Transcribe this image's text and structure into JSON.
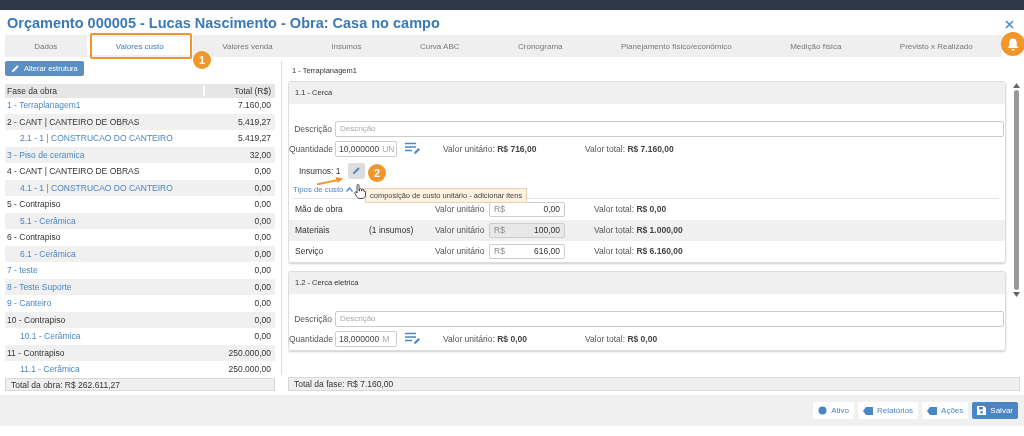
{
  "window": {
    "title": "Orçamento 000005 - Lucas Nascimento - Obra: Casa no campo"
  },
  "tabs": [
    {
      "label": "Dados",
      "selected": false
    },
    {
      "label": "Valores custo",
      "selected": true
    },
    {
      "label": "Valores venda",
      "selected": false
    },
    {
      "label": "Insumos",
      "selected": false
    },
    {
      "label": "Curva ABC",
      "selected": false
    },
    {
      "label": "Cronograma",
      "selected": false
    },
    {
      "label": "Planejamento físico/econômico",
      "selected": false
    },
    {
      "label": "Medição física",
      "selected": false
    },
    {
      "label": "Previsto x Realizado",
      "selected": false
    }
  ],
  "left_panel": {
    "button": "Alterar estrutura",
    "table": {
      "columns": [
        "Fase da obra",
        "Total (R$)"
      ],
      "rows": [
        {
          "label": "1 - Terraplanagem1",
          "total": "7.160,00"
        },
        {
          "label": "2 - CANT | CANTEIRO DE OBRAS",
          "total": "5.419,27",
          "children": [
            {
              "label": "2.1 - 1 | CONSTRUCAO DO CANTEIRO",
              "total": "5.419,27"
            }
          ]
        },
        {
          "label": "3 - Piso de ceramica",
          "total": "32,00"
        },
        {
          "label": "4 - CANT | CANTEIRO DE OBRAS",
          "total": "0,00",
          "children": [
            {
              "label": "4.1 - 1 | CONSTRUCAO DO CANTEIRO",
              "total": "0,00"
            }
          ]
        },
        {
          "label": "5 - Contrapiso",
          "total": "0,00",
          "children": [
            {
              "label": "5.1 - Cerâmica",
              "total": "0,00"
            }
          ]
        },
        {
          "label": "6 - Contrapiso",
          "total": "0,00",
          "children": [
            {
              "label": "6.1 - Cerâmica",
              "total": "0,00"
            }
          ]
        },
        {
          "label": "7 - teste",
          "total": "0,00"
        },
        {
          "label": "8 - Teste Suporte",
          "total": "0,00"
        },
        {
          "label": "9 - Canteiro",
          "total": "0,00"
        },
        {
          "label": "10 - Contrapiso",
          "total": "0,00",
          "children": [
            {
              "label": "10.1 - Cerâmica",
              "total": "0,00"
            }
          ]
        },
        {
          "label": "11 - Contrapiso",
          "total": "250.000,00",
          "children": [
            {
              "label": "11.1 - Cerâmica",
              "total": "250.000,00"
            }
          ]
        }
      ]
    },
    "total": "Total da obra: R$ 262.611,27"
  },
  "right_panel": {
    "heading": "1 - Terraplanagem1",
    "cards": [
      {
        "title": "1.1 - Cerca",
        "description_label": "Descrição",
        "description_placeholder": "Descrição",
        "quantity_label": "Quantidade",
        "quantity": "10,000000",
        "unit": "UN",
        "unit_price_label": "Valor unitário:",
        "unit_price": "R$ 716,00",
        "total_label": "Valor total:",
        "total": "R$ 7.160,00",
        "insumos": "Insumos: 1",
        "cost_types": {
          "label": "Tipos de custo",
          "expanded": true,
          "rows": [
            {
              "name": "Mão de obra",
              "note": "",
              "unit_label": "Valor unitário",
              "currency": "R$",
              "value": "0,00",
              "disabled": false,
              "total_label": "Valor total:",
              "total": "R$ 0,00"
            },
            {
              "name": "Materiais",
              "note": "(1 insumos)",
              "unit_label": "Valor unitário",
              "currency": "R$",
              "value": "100,00",
              "disabled": true,
              "total_label": "Valor total:",
              "total": "R$ 1.000,00"
            },
            {
              "name": "Serviço",
              "note": "",
              "unit_label": "Valor unitário",
              "currency": "R$",
              "value": "616,00",
              "disabled": false,
              "total_label": "Valor total:",
              "total": "R$ 6.160,00"
            }
          ]
        }
      },
      {
        "title": "1.2 - Cerca eletrica",
        "description_label": "Descrição",
        "description_placeholder": "Descrição",
        "quantity_label": "Quantidade",
        "quantity": "18,000000",
        "unit": "M",
        "unit_price_label": "Valor unitário:",
        "unit_price": "R$ 0,00",
        "total_label": "Valor total:",
        "total": "R$ 0,00"
      }
    ],
    "total": "Total da fase: R$ 7.160,00"
  },
  "tooltip": "composição de custo unitário - adicionar itens",
  "callouts": [
    "1",
    "2"
  ],
  "footer_buttons": [
    {
      "label": "Ativo",
      "kind": "status"
    },
    {
      "label": "Relatórios",
      "kind": "tag"
    },
    {
      "label": "Ações",
      "kind": "tag"
    },
    {
      "label": "Salvar",
      "kind": "primary"
    }
  ]
}
